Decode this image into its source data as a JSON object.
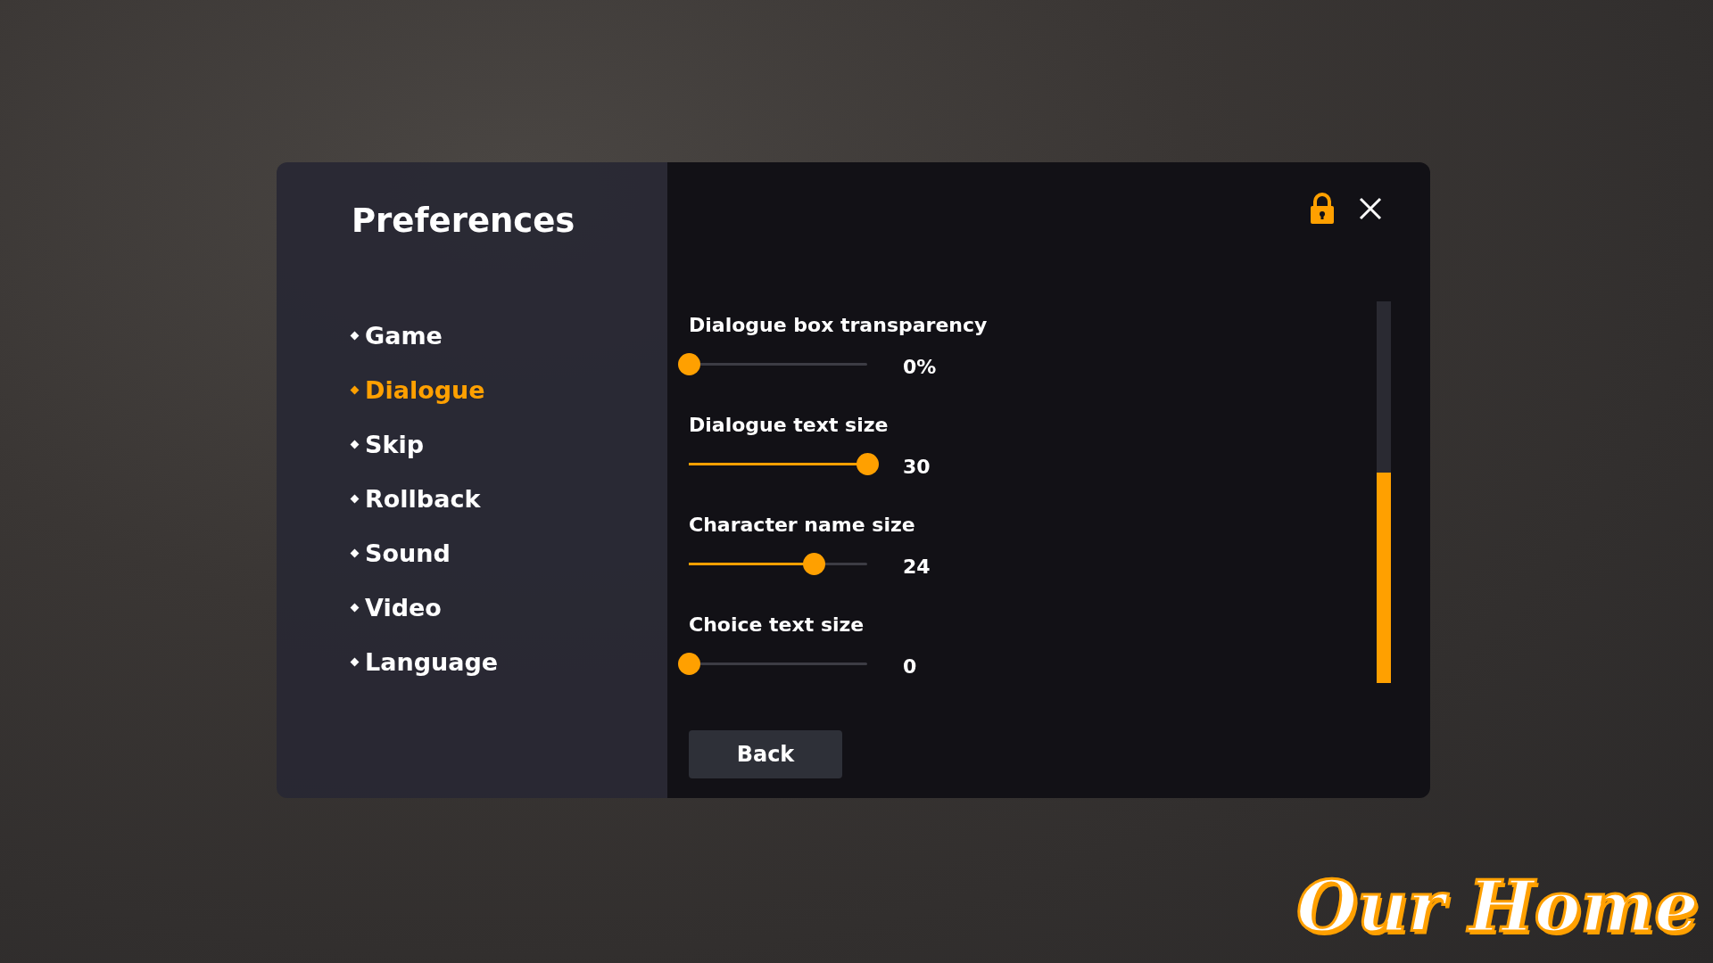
{
  "title": "Preferences",
  "nav": [
    {
      "label": "Game",
      "selected": false
    },
    {
      "label": "Dialogue",
      "selected": true
    },
    {
      "label": "Skip",
      "selected": false
    },
    {
      "label": "Rollback",
      "selected": false
    },
    {
      "label": "Sound",
      "selected": false
    },
    {
      "label": "Video",
      "selected": false
    },
    {
      "label": "Language",
      "selected": false
    }
  ],
  "settings": [
    {
      "label": "Dialogue box transparency",
      "level": 0,
      "reading": "0%"
    },
    {
      "label": "Dialogue text size",
      "level": 1,
      "reading": "30"
    },
    {
      "label": "Character name size",
      "level": 0.7,
      "reading": "24"
    },
    {
      "label": "Choice text size",
      "level": 0,
      "reading": "0"
    }
  ],
  "back_button": "Back",
  "logo": "Our Home"
}
